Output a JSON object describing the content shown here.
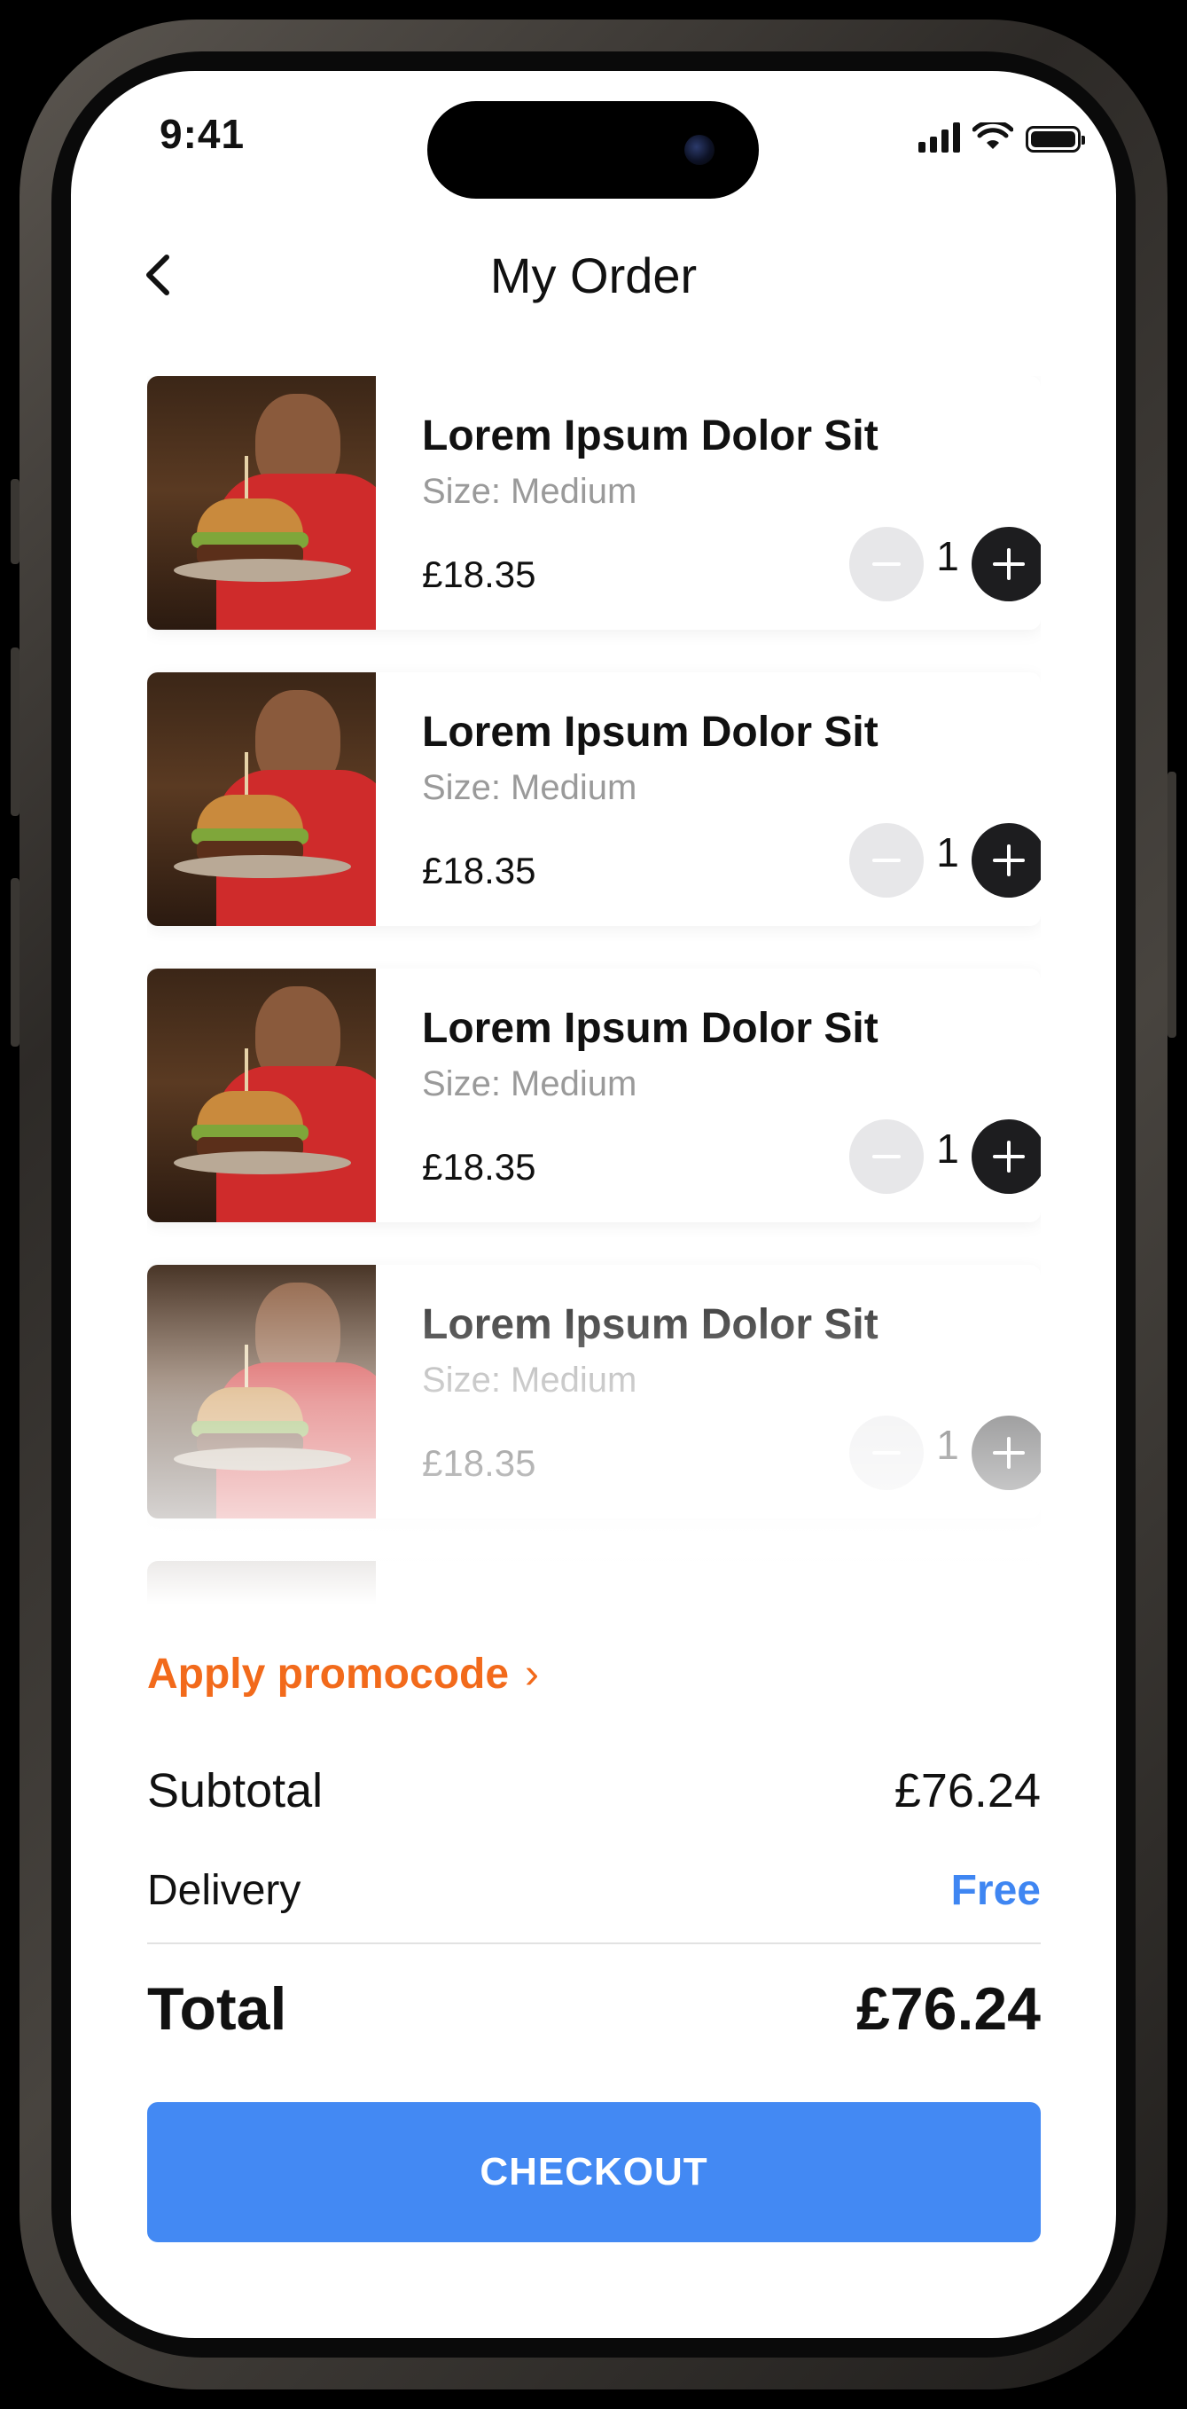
{
  "status_bar": {
    "time": "9:41"
  },
  "header": {
    "title": "My Order"
  },
  "cart": {
    "items": [
      {
        "name": "Lorem Ipsum Dolor Sit",
        "size": "Size: Medium",
        "price": "£18.35",
        "quantity": "1"
      },
      {
        "name": "Lorem Ipsum Dolor Sit",
        "size": "Size: Medium",
        "price": "£18.35",
        "quantity": "1"
      },
      {
        "name": "Lorem Ipsum Dolor Sit",
        "size": "Size: Medium",
        "price": "£18.35",
        "quantity": "1"
      },
      {
        "name": "Lorem Ipsum Dolor Sit",
        "size": "Size: Medium",
        "price": "£18.35",
        "quantity": "1"
      }
    ]
  },
  "promo": {
    "label": "Apply promocode",
    "chevron": "›"
  },
  "summary": {
    "subtotal_label": "Subtotal",
    "subtotal_value": "£76.24",
    "delivery_label": "Delivery",
    "delivery_value": "Free",
    "total_label": "Total",
    "total_value": "£76.24"
  },
  "checkout": {
    "label": "CHECKOUT"
  },
  "colors": {
    "accent": "#4389f3",
    "promo": "#f26a1b",
    "delivery_free": "#3f86f2",
    "plus_button": "#1d1d1f"
  },
  "icons": {
    "back": "chevron-left-icon",
    "minus": "minus-icon",
    "plus": "plus-icon"
  }
}
